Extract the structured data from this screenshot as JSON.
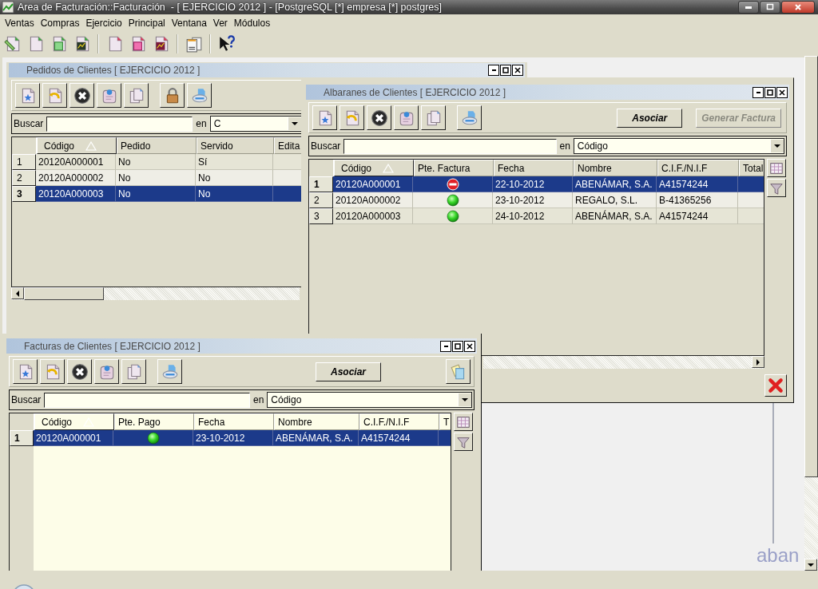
{
  "window": {
    "title": "Area de Facturación::Facturación  - [ EJERCICIO 2012 ] - [PostgreSQL [*] empresa [*] postgres]"
  },
  "menu": [
    "Ventas",
    "Compras",
    "Ejercicio",
    "Principal",
    "Ventana",
    "Ver",
    "Módulos"
  ],
  "child_windows": [
    {
      "title": "Pedidos de Clientes [ EJERCICIO 2012 ]",
      "search": {
        "label": "Buscar",
        "in_label": "en",
        "field_value": "C"
      },
      "table": {
        "columns": [
          {
            "label": "Código",
            "kind": "text",
            "sorted": true
          },
          {
            "label": "Pedido",
            "kind": "text",
            "sorted": false
          },
          {
            "label": "Servido",
            "kind": "text",
            "sorted": false
          },
          {
            "label": "Edita",
            "kind": "text",
            "sorted": false
          }
        ],
        "rows": [
          {
            "number": "1",
            "selected": false,
            "cells": [
              "20120A000001",
              "No",
              "Sí"
            ]
          },
          {
            "number": "2",
            "selected": false,
            "cells": [
              "20120A000002",
              "No",
              "No"
            ]
          },
          {
            "number": "3",
            "selected": true,
            "cells": [
              "20120A000003",
              "No",
              "No"
            ]
          }
        ]
      }
    },
    {
      "title": "Albaranes de Clientes [ EJERCICIO 2012 ]",
      "buttons": [
        {
          "label": "Asociar",
          "disabled": false
        },
        {
          "label": "Generar Factura",
          "disabled": true
        }
      ],
      "search": {
        "label": "Buscar",
        "in_label": "en",
        "field_value": "Código"
      },
      "table": {
        "columns": [
          {
            "label": "Código",
            "kind": "text",
            "sorted": true
          },
          {
            "label": "Pte. Factura",
            "kind": "status",
            "sorted": false
          },
          {
            "label": "Fecha",
            "kind": "text",
            "sorted": false
          },
          {
            "label": "Nombre",
            "kind": "text",
            "sorted": false
          },
          {
            "label": "C.I.F./N.I.F",
            "kind": "text",
            "sorted": false
          },
          {
            "label": "Total",
            "kind": "text",
            "sorted": false
          }
        ],
        "rows": [
          {
            "number": "1",
            "selected": true,
            "blocked": true,
            "cells": [
              "20120A000001",
              "",
              "22-10-2012",
              "ABENÁMAR, S.A.",
              "A41574244"
            ]
          },
          {
            "number": "2",
            "selected": false,
            "blocked": false,
            "cells": [
              "20120A000002",
              "",
              "23-10-2012",
              "REGALO, S.L.",
              "B-41365256"
            ]
          },
          {
            "number": "3",
            "selected": false,
            "blocked": false,
            "cells": [
              "20120A000003",
              "",
              "24-10-2012",
              "ABENÁMAR, S.A.",
              "A41574244"
            ]
          }
        ]
      }
    },
    {
      "title": "Facturas de Clientes [ EJERCICIO 2012 ]",
      "buttons": [
        {
          "label": "Asociar",
          "disabled": false
        }
      ],
      "search": {
        "label": "Buscar",
        "in_label": "en",
        "field_value": "Código"
      },
      "table": {
        "columns": [
          {
            "label": "Código",
            "kind": "text",
            "sorted": true
          },
          {
            "label": "Pte. Pago",
            "kind": "status",
            "sorted": false
          },
          {
            "label": "Fecha",
            "kind": "text",
            "sorted": false
          },
          {
            "label": "Nombre",
            "kind": "text",
            "sorted": false
          },
          {
            "label": "C.I.F./N.I.F",
            "kind": "text",
            "sorted": false
          },
          {
            "label": "T",
            "kind": "text",
            "sorted": false
          }
        ],
        "rows": [
          {
            "number": "1",
            "selected": true,
            "blocked": false,
            "cells": [
              "20120A000001",
              "",
              "23-10-2012",
              "ABENÁMAR, S.A.",
              "A41574244"
            ]
          }
        ]
      }
    }
  ],
  "logo": "aban"
}
